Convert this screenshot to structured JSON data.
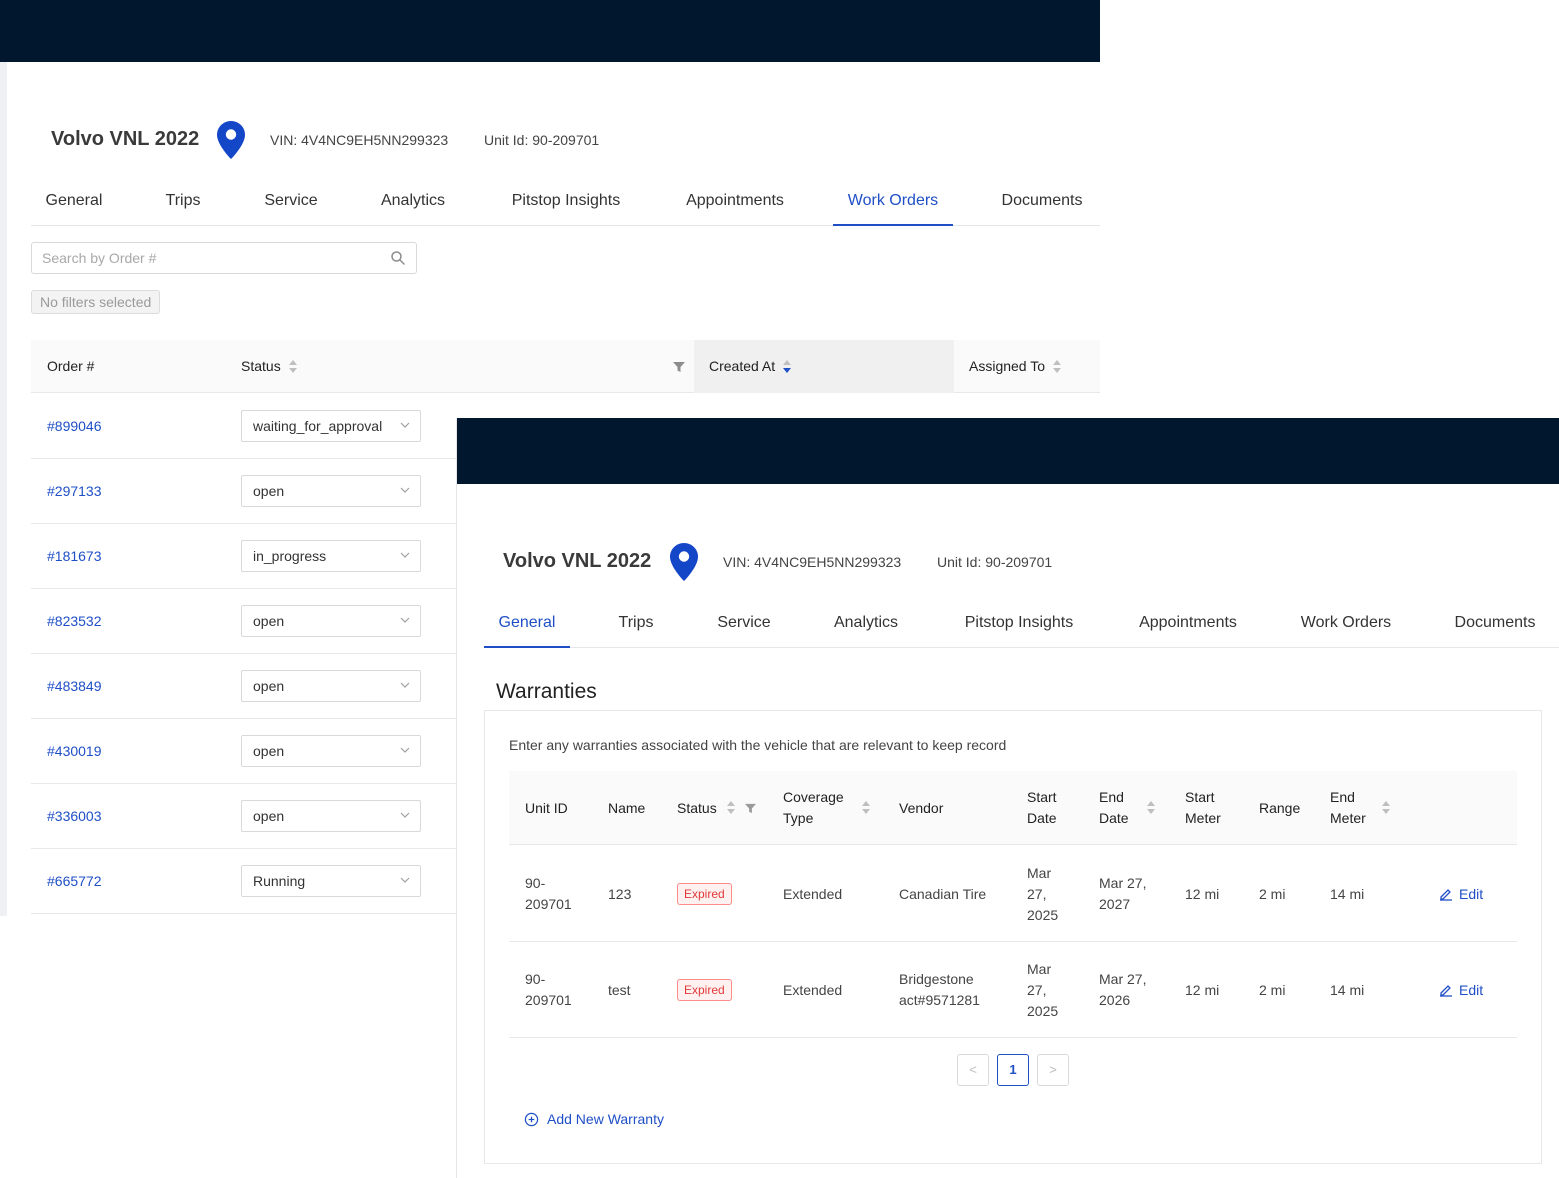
{
  "vehicle": {
    "title": "Volvo VNL 2022",
    "vin": "VIN: 4V4NC9EH5NN299323",
    "unit_id": "Unit Id: 90-209701"
  },
  "tabs": [
    "General",
    "Trips",
    "Service",
    "Analytics",
    "Pitstop Insights",
    "Appointments",
    "Work Orders",
    "Documents"
  ],
  "work_orders": {
    "active_tab": "Work Orders",
    "search": {
      "placeholder": "Search by Order #"
    },
    "filters_label": "No filters selected",
    "columns": [
      "Order #",
      "Status",
      "Created At",
      "Assigned To"
    ],
    "rows": [
      {
        "order": "#899046",
        "status": "waiting_for_approval"
      },
      {
        "order": "#297133",
        "status": "open"
      },
      {
        "order": "#181673",
        "status": "in_progress"
      },
      {
        "order": "#823532",
        "status": "open"
      },
      {
        "order": "#483849",
        "status": "open"
      },
      {
        "order": "#430019",
        "status": "open"
      },
      {
        "order": "#336003",
        "status": "open"
      },
      {
        "order": "#665772",
        "status": "Running"
      }
    ]
  },
  "warranties": {
    "active_tab": "General",
    "title": "Warranties",
    "description": "Enter any warranties associated with the vehicle that are relevant to keep record",
    "columns": [
      "Unit ID",
      "Name",
      "Status",
      "Coverage\nType",
      "Vendor",
      "Start\nDate",
      "End\nDate",
      "Start\nMeter",
      "Range",
      "End\nMeter"
    ],
    "rows": [
      {
        "unit_id": "90-\n209701",
        "name": "123",
        "status": "Expired",
        "coverage": "Extended",
        "vendor": "Canadian Tire",
        "start_date": "Mar\n27,\n2025",
        "end_date": "Mar 27,\n2027",
        "start_meter": "12 mi",
        "range": "2 mi",
        "end_meter": "14 mi",
        "action": "Edit"
      },
      {
        "unit_id": "90-\n209701",
        "name": "test",
        "status": "Expired",
        "coverage": "Extended",
        "vendor": "Bridgestone\nact#9571281",
        "start_date": "Mar\n27,\n2025",
        "end_date": "Mar 27,\n2026",
        "start_meter": "12 mi",
        "range": "2 mi",
        "end_meter": "14 mi",
        "action": "Edit"
      }
    ],
    "pagination": {
      "prev": "<",
      "current": "1",
      "next": ">"
    },
    "add_label": "Add New Warranty"
  },
  "colors": {
    "topbar": "#00172d",
    "accent": "#1f4fc6",
    "expired": "#e03a3a"
  }
}
